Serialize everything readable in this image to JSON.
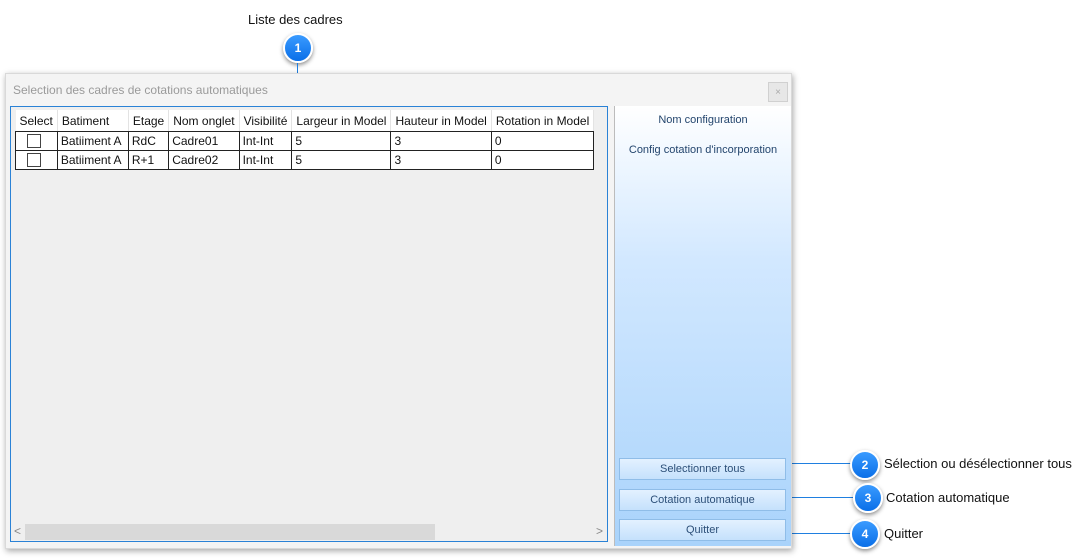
{
  "callouts": {
    "c1": {
      "num": "1",
      "label": "Liste des cadres"
    },
    "c2": {
      "num": "2",
      "label": "Sélection ou désélectionner tous"
    },
    "c3": {
      "num": "3",
      "label": "Cotation automatique"
    },
    "c4": {
      "num": "4",
      "label": "Quitter"
    }
  },
  "window": {
    "title": "Selection des cadres de cotations automatiques",
    "close_glyph": "×"
  },
  "grid": {
    "columns": [
      "Select",
      "Batiment",
      "Etage",
      "Nom onglet",
      "Visibilité",
      "Largeur in Model",
      "Hauteur in Model",
      "Rotation in Model"
    ],
    "rows": [
      {
        "selected": false,
        "batiment": "Batiiment A",
        "etage": "RdC",
        "nom_onglet": "Cadre01",
        "visibilite": "Int-Int",
        "largeur": "5",
        "hauteur": "3",
        "rotation": "0"
      },
      {
        "selected": false,
        "batiment": "Batiiment A",
        "etage": "R+1",
        "nom_onglet": "Cadre02",
        "visibilite": "Int-Int",
        "largeur": "5",
        "hauteur": "3",
        "rotation": "0"
      }
    ],
    "scroll_left": "<",
    "scroll_right": ">"
  },
  "side": {
    "label1": "Nom configuration",
    "label2": "Config cotation d'incorporation",
    "btn_select_all": "Selectionner tous",
    "btn_auto": "Cotation automatique",
    "btn_quit": "Quitter"
  },
  "colors": {
    "badge": "#1a84f5",
    "panel_border": "#2a82d6",
    "side_gradient_end": "#a9d3fb"
  }
}
